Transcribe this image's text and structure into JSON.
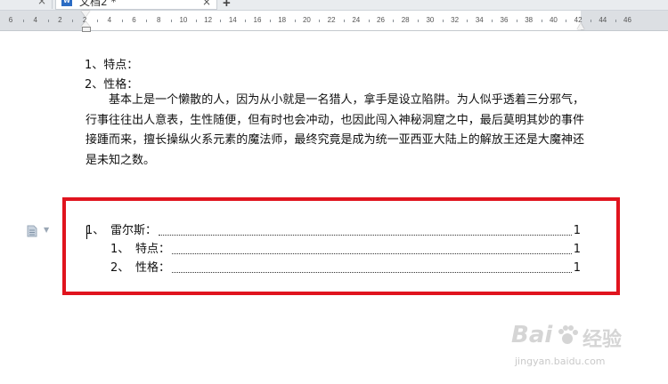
{
  "tabs": {
    "document_tab_title": "文档2 *",
    "close_glyph": "×",
    "new_tab_glyph": "+"
  },
  "ruler": {
    "numbers": [
      "6",
      "4",
      "2",
      "2",
      "4",
      "6",
      "8",
      "10",
      "12",
      "14",
      "16",
      "18",
      "20",
      "22",
      "24",
      "26",
      "28",
      "30",
      "32",
      "34",
      "36",
      "38",
      "40",
      "42",
      "44",
      "46"
    ]
  },
  "doc": {
    "line1": "1、特点：",
    "line2": "2、性格：",
    "paragraph": "基本上是一个懒散的人，因为从小就是一名猎人，拿手是设立陷阱。为人似乎透着三分邪气，行事往往出人意表，生性随便，但有时也会冲动，也因此闯入神秘洞窟之中，最后莫明其妙的事件接踵而来，擅长操纵火系元素的魔法师，最终究竟是成为统一亚西亚大陆上的解放王还是大魔神还是未知之数。"
  },
  "toc": {
    "entries": [
      {
        "num": "1、",
        "label": "雷尔斯：",
        "page": "1"
      },
      {
        "num": "1、",
        "label": "特点：",
        "page": "1"
      },
      {
        "num": "2、",
        "label": "性格：",
        "page": "1"
      }
    ]
  },
  "colors": {
    "highlight_border": "#e0141e",
    "ruler_bg": "#dcdfe3"
  },
  "watermark": {
    "brand": "Bai",
    "brand_suffix": "经验",
    "url": "jingyan.baidu.com"
  }
}
